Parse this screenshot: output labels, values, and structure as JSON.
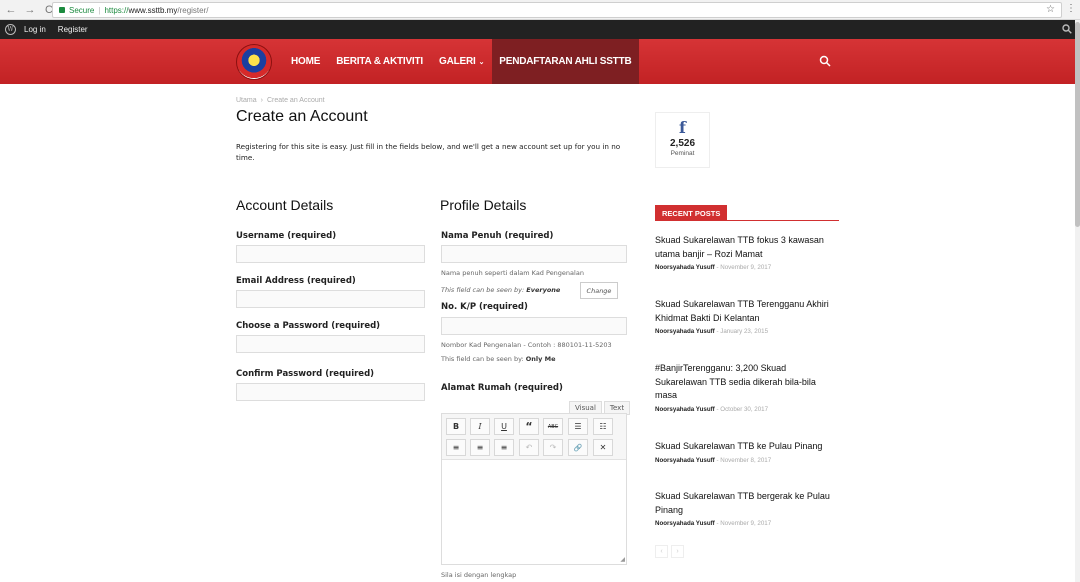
{
  "browser": {
    "secure_label": "Secure",
    "separator": "|",
    "url_proto": "https://",
    "url_host": "www.ssttb.my",
    "url_path": "/register/"
  },
  "adminbar": {
    "login": "Log in",
    "register": "Register"
  },
  "nav": {
    "items": [
      {
        "label": "HOME"
      },
      {
        "label": "BERITA & AKTIVITI"
      },
      {
        "label": "GALERI"
      },
      {
        "label": "PENDAFTARAN AHLI SSTTB"
      }
    ]
  },
  "breadcrumb": {
    "home": "Utama",
    "separator": "›",
    "current": "Create an Account"
  },
  "page": {
    "title": "Create an Account",
    "intro": "Registering for this site is easy. Just fill in the fields below, and we'll get a new account set up for you in no time."
  },
  "account": {
    "heading": "Account Details",
    "username_label": "Username (required)",
    "email_label": "Email Address (required)",
    "password_label": "Choose a Password (required)",
    "confirm_label": "Confirm Password (required)"
  },
  "profile": {
    "heading": "Profile Details",
    "fullname_label": "Nama Penuh (required)",
    "fullname_hint": "Nama penuh seperti dalam Kad Pengenalan",
    "visibility1_prefix": "This field can be seen by:",
    "visibility1_value": "Everyone",
    "change_label": "Change",
    "ic_label": "No. K/P (required)",
    "ic_hint": "Nombor Kad Pengenalan - Contoh : 880101-11-5203",
    "visibility2_prefix": "This field can be seen by:",
    "visibility2_value": "Only Me",
    "address_label": "Alamat Rumah (required)",
    "tab_visual": "Visual",
    "tab_text": "Text",
    "address_hint": "Sila isi dengan lengkap"
  },
  "editor_buttons": {
    "row1": [
      "B",
      "I",
      "U",
      "“",
      "ABC",
      "☰",
      "☷"
    ],
    "row2": [
      "≡",
      "≡",
      "≡",
      "↶",
      "↷",
      "🔗",
      "✕"
    ]
  },
  "sidebar": {
    "fb_icon": "f",
    "fb_count": "2,526",
    "fb_label": "Peminat",
    "recent_heading": "RECENT POSTS",
    "posts": [
      {
        "title": "Skuad Sukarelawan TTB fokus 3 kawasan utama banjir – Rozi Mamat",
        "author": "Noorsyahada Yusuff",
        "date": "November 9, 2017"
      },
      {
        "title": "Skuad Sukarelawan TTB Terengganu Akhiri Khidmat Bakti Di Kelantan",
        "author": "Noorsyahada Yusuff",
        "date": "January 23, 2015"
      },
      {
        "title": "#BanjirTerengganu: 3,200 Skuad Sukarelawan TTB sedia dikerah bila-bila masa",
        "author": "Noorsyahada Yusuff",
        "date": "October 30, 2017"
      },
      {
        "title": "Skuad Sukarelawan TTB ke Pulau Pinang",
        "author": "Noorsyahada Yusuff",
        "date": "November 8, 2017"
      },
      {
        "title": "Skuad Sukarelawan TTB bergerak ke Pulau Pinang",
        "author": "Noorsyahada Yusuff",
        "date": "November 9, 2017"
      }
    ],
    "date_separator": "-",
    "prev": "‹",
    "next": "›"
  },
  "colors": {
    "brand_red": "#d12f30",
    "active_menu": "#7e1f22",
    "facebook": "#3b5998"
  }
}
